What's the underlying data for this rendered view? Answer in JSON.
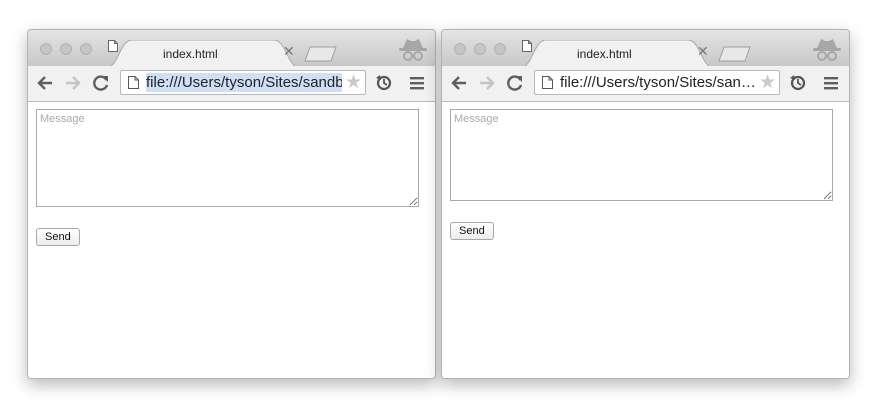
{
  "windows": [
    {
      "tab": {
        "title": "index.html"
      },
      "address_bar": {
        "url": "file:///Users/tyson/Sites/sandbox/index.html",
        "selected": true
      },
      "form": {
        "message_placeholder": "Message",
        "send_label": "Send"
      }
    },
    {
      "tab": {
        "title": "index.html"
      },
      "address_bar": {
        "url": "file:///Users/tyson/Sites/sandbox/index.html",
        "selected": false
      },
      "form": {
        "message_placeholder": "Message",
        "send_label": "Send"
      }
    }
  ],
  "icons": [
    "window-close-light",
    "window-minimize-light",
    "window-zoom-light",
    "page-icon",
    "tab-close-icon",
    "new-tab-icon",
    "incognito-icon",
    "back-arrow-icon",
    "forward-arrow-icon",
    "reload-icon",
    "bookmark-star-icon",
    "extension-sync-icon",
    "menu-icon"
  ],
  "colors": {
    "chrome_frame": "#d6d6d6",
    "toolbar": "#f1f1f1",
    "url_selection": "#cfdff6"
  }
}
